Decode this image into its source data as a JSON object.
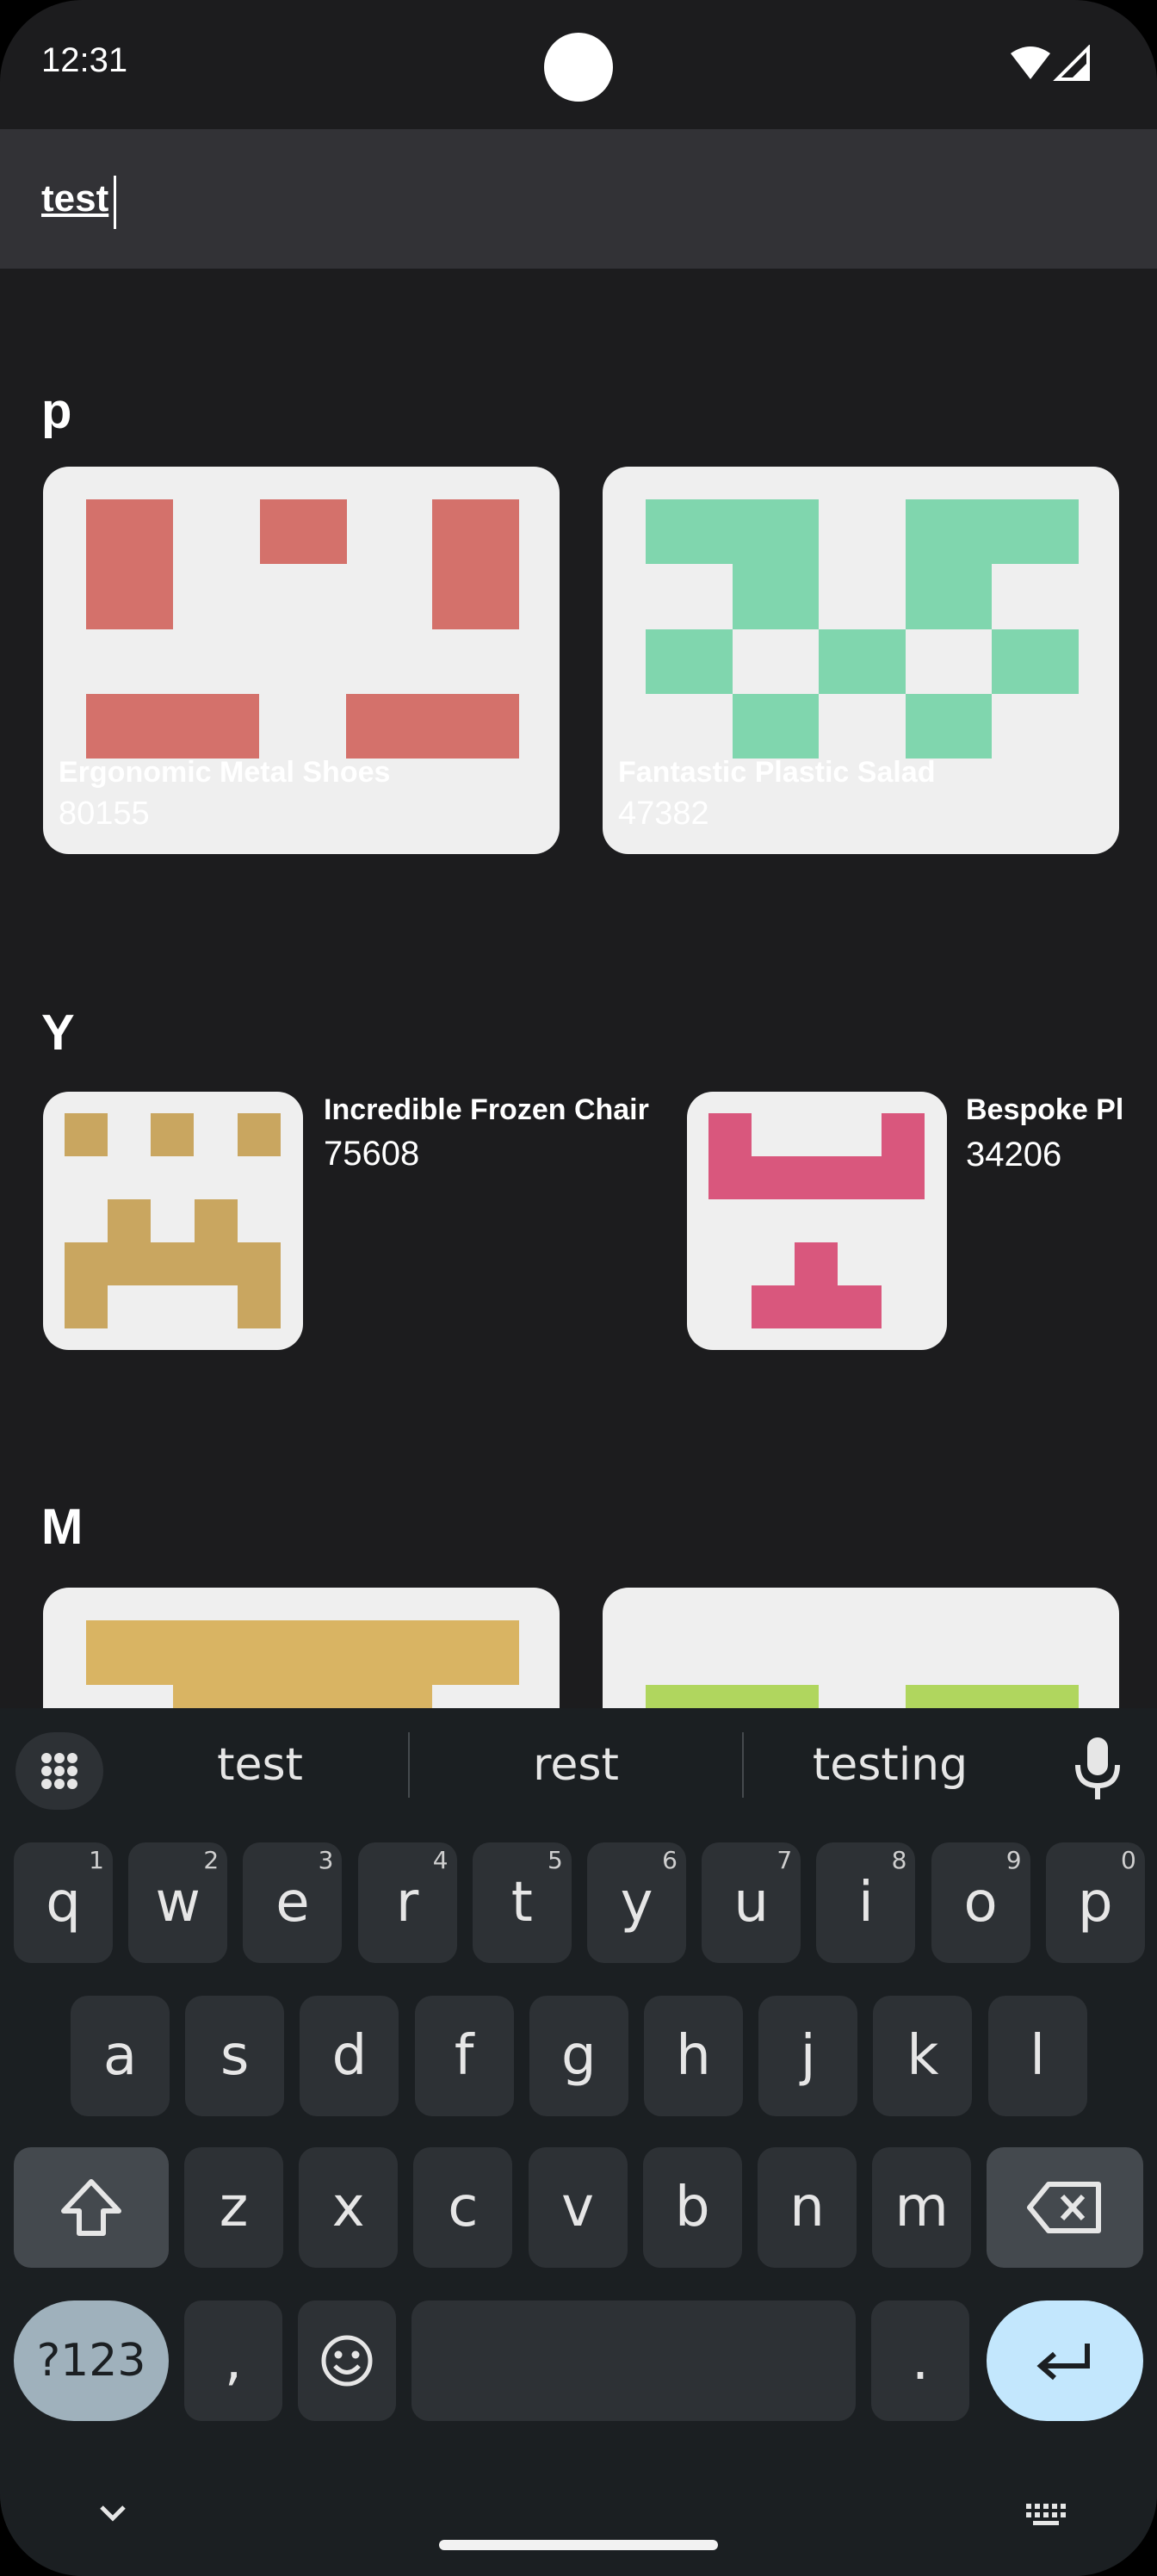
{
  "status": {
    "time": "12:31"
  },
  "search": {
    "query": "test"
  },
  "sections": [
    {
      "label": "p",
      "items": [
        {
          "name": "Ergonomic Metal Shoes",
          "number": "80155",
          "color": "#d4716b"
        },
        {
          "name": "Fantastic Plastic Salad",
          "number": "47382",
          "color": "#80d6ae"
        }
      ]
    },
    {
      "label": "Y",
      "items": [
        {
          "name": "Incredible Frozen Chair",
          "number": "75608",
          "color": "#c9a660"
        },
        {
          "name": "Bespoke Pl",
          "number": "34206",
          "color": "#d9577d"
        }
      ]
    },
    {
      "label": "M",
      "items": [
        {
          "color": "#d9b463"
        },
        {
          "color": "#b0d65e"
        }
      ]
    }
  ],
  "keyboard": {
    "suggestions": [
      "test",
      "rest",
      "testing"
    ],
    "row1": [
      {
        "k": "q",
        "h": "1"
      },
      {
        "k": "w",
        "h": "2"
      },
      {
        "k": "e",
        "h": "3"
      },
      {
        "k": "r",
        "h": "4"
      },
      {
        "k": "t",
        "h": "5"
      },
      {
        "k": "y",
        "h": "6"
      },
      {
        "k": "u",
        "h": "7"
      },
      {
        "k": "i",
        "h": "8"
      },
      {
        "k": "o",
        "h": "9"
      },
      {
        "k": "p",
        "h": "0"
      }
    ],
    "row2": [
      "a",
      "s",
      "d",
      "f",
      "g",
      "h",
      "j",
      "k",
      "l"
    ],
    "row3": [
      "z",
      "x",
      "c",
      "v",
      "b",
      "n",
      "m"
    ],
    "symbols_label": "?123",
    "comma": ",",
    "period": "."
  }
}
